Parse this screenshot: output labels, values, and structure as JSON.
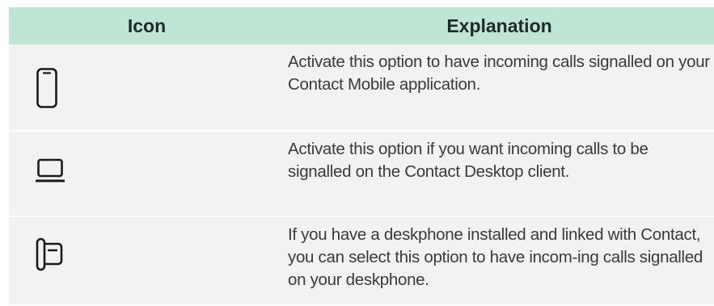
{
  "table": {
    "headers": {
      "icon": "Icon",
      "explanation": "Explanation"
    },
    "rows": [
      {
        "icon": "mobile-phone-icon",
        "text": "Activate this option to have incoming calls signalled on your Contact Mobile application."
      },
      {
        "icon": "laptop-icon",
        "text": "Activate this option if you want incoming calls to be signalled on the Contact Desktop client."
      },
      {
        "icon": "deskphone-icon",
        "text": "If you have a deskphone installed and linked with Contact, you can select this option to have incom-ing calls signalled on your deskphone."
      }
    ]
  },
  "colors": {
    "header_bg": "#bfe6d5",
    "row_bg": "#f2f2f2",
    "text": "#3a3a3a",
    "icon_stroke": "#1a1a1a"
  }
}
